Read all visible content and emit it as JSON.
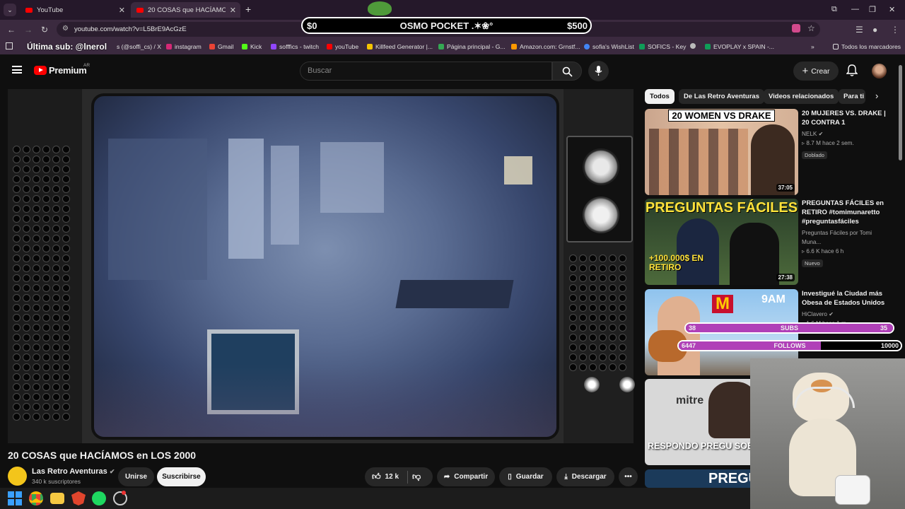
{
  "browser": {
    "tabs": [
      {
        "title": "YouTube",
        "active": false
      },
      {
        "title": "20 COSAS que HACÍAMOS en L",
        "active": true
      }
    ],
    "new_tab": "+",
    "url": "youtube.com/watch?v=L5BrE9AcGzE",
    "bookmarks": [
      "s (@soffi_cs) / X",
      "instagram",
      "Gmail",
      "Kick",
      "sofffics - twitch",
      "youTube",
      "Killfeed Generator |...",
      "Página principal - G...",
      "Amazon.com: Grnstf...",
      "sofia's WishList",
      "SOFICS - Key",
      "EVOPLAY x SPAIN -...",
      "»",
      "Todos los marcadores"
    ]
  },
  "stream_overlay": {
    "goal": {
      "left": "$0",
      "label": "OSMO POCKET .✶❀°",
      "right": "$500"
    },
    "ultima_sub": "Última sub: @lnerol",
    "subs_bar": {
      "left": "38",
      "label": "SUBS",
      "right": "35",
      "fill": 1.0
    },
    "follows_bar": {
      "left": "6447",
      "label": "FOLLOWS",
      "right": "10000",
      "fill": 0.64
    }
  },
  "masthead": {
    "logo": "Premium",
    "country": "AR",
    "search_placeholder": "Buscar",
    "create": "Crear"
  },
  "video": {
    "title": "20 COSAS que HACÍAMOS en LOS 2000",
    "channel": "Las Retro Aventuras",
    "subscribers": "340 k suscriptores",
    "join": "Unirse",
    "subscribe": "Suscribirse",
    "likes": "12 k",
    "share": "Compartir",
    "save": "Guardar",
    "download": "Descargar"
  },
  "chips": [
    "Todos",
    "De Las Retro Aventuras",
    "Videos relacionados",
    "Para ti"
  ],
  "recommendations": [
    {
      "title": "20 MUJERES VS. DRAKE | 20 CONTRA 1",
      "channel": "NELK",
      "meta": "8.7 M  hace 2 sem.",
      "badge": "Doblado",
      "duration": "37:05",
      "caption": "20 WOMEN VS DRAKE"
    },
    {
      "title": "PREGUNTAS FÁCILES en RETIRO #tomimunaretto #preguntasfáciles",
      "channel": "Preguntas Fáciles por Tomi Muna...",
      "meta": "6.6 K  hace 6 h",
      "badge": "Nuevo",
      "duration": "27:38",
      "caption": "PREGUNTAS FÁCILES",
      "caption2": "+100.000$ EN RETIRO"
    },
    {
      "title": "Investigué la Ciudad más Obesa de Estados Unidos",
      "channel": "HiClavero",
      "meta": "1.6 M  hace 1 m",
      "caption": "9AM"
    },
    {
      "caption": "RESPONDO PREGU SOBRE MARC",
      "caption_top": "mitre"
    },
    {
      "caption": "PREGU"
    }
  ],
  "colors": {
    "accent": "#ff0000",
    "overlay_purple": "#b040b8",
    "bg": "#0f0f0f"
  }
}
